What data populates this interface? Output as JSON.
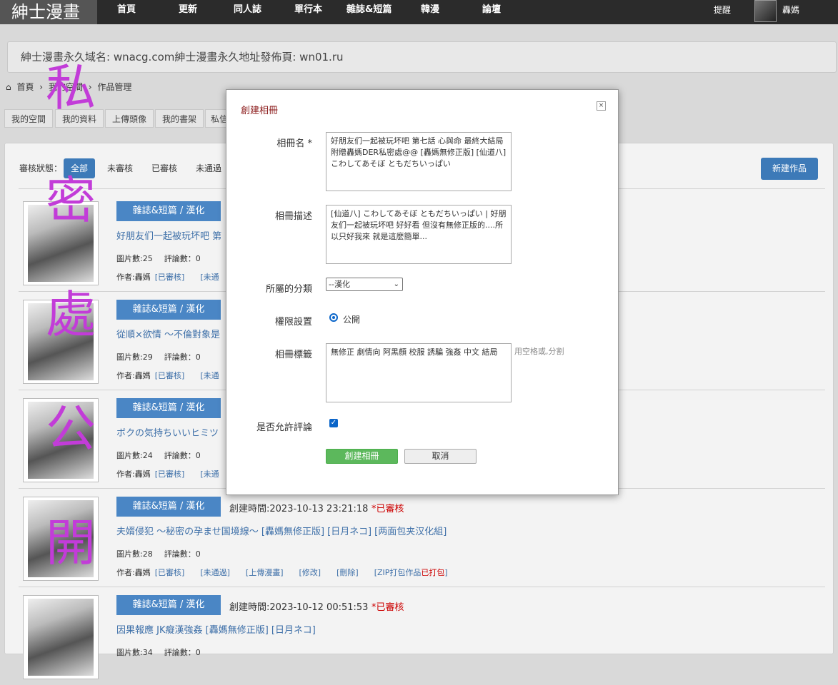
{
  "nav": {
    "logo": "紳士漫畫",
    "items": [
      "首頁",
      "更新",
      "同人誌",
      "單行本",
      "雜誌&短篇",
      "韓漫",
      "論壇"
    ],
    "remind": "提醒",
    "username": "轟媽"
  },
  "notice": "紳士漫畫永久域名: wnacg.com紳士漫畫永久地址發佈頁: wn01.ru",
  "breadcrumb": [
    "首頁",
    "我的空間",
    "作品管理"
  ],
  "subtabs": [
    "我的空間",
    "我的資料",
    "上傳頭像",
    "我的書架",
    "私信"
  ],
  "filter": {
    "label": "審核狀態：",
    "options": [
      "全部",
      "未審核",
      "已審核",
      "未通過"
    ]
  },
  "new_button": "新建作品",
  "watermark": [
    "私",
    "密",
    "處",
    "公",
    "開"
  ],
  "items": [
    {
      "category": "雜誌&短篇 / 漢化",
      "title": "好朋友们一起被玩坏吧 第",
      "meta": [
        "圖片數:25",
        "評論數：0"
      ],
      "author": "作者:轟媽",
      "links": [
        "[已審核]",
        "[未通"
      ]
    },
    {
      "category": "雜誌&短篇 / 漢化",
      "title": "從順×欲情 ～不倫對象是",
      "meta": [
        "圖片數:29",
        "評論數：0"
      ],
      "author": "作者:轟媽",
      "links": [
        "[已審核]",
        "[未通"
      ]
    },
    {
      "category": "雜誌&短篇 / 漢化",
      "title": "ボクの気持ちいいヒミツ",
      "meta": [
        "圖片數:24",
        "評論數：0"
      ],
      "author": "作者:轟媽",
      "links": [
        "[已審核]",
        "[未通"
      ]
    },
    {
      "category": "雜誌&短篇 / 漢化",
      "title": "夫婿侵犯 ～秘密の孕ませ国境線～ [轟媽無修正版] [日月ネコ] [两面包夹汉化組]",
      "meta": [
        "圖片數:28",
        "評論數：0"
      ],
      "author": "作者:轟媽",
      "links": [
        "[已審核]",
        "[未通過]",
        "[上傳漫畫]",
        "[修改]",
        "[刪除]"
      ],
      "zip": "[ZIP打包作品",
      "zip_red": "已打包",
      "zip_end": "]",
      "time": "創建時間:2023-10-13 23:21:18",
      "status": "*已審核"
    },
    {
      "category": "雜誌&短篇 / 漢化",
      "title": "因果報應 JK癡漢強姦 [轟媽無修正版] [日月ネコ]",
      "meta": [
        "圖片數:34",
        "評論數：0"
      ],
      "author": "",
      "links": [],
      "time": "創建時間:2023-10-12 00:51:53",
      "status": "*已審核"
    }
  ],
  "modal": {
    "title": "創建相冊",
    "close": "×",
    "name_label": "相冊名 *",
    "name_value": "好朋友们一起被玩坏吧 第七話 心與命 最終大結局 附贈轟媽DER私密處@@ [轟媽無修正版] [仙道八] こわしてあそぼ ともだちいっぱい",
    "desc_label": "相冊描述",
    "desc_value": "[仙道八] こわしてあそぼ ともだちいっぱい | 好朋友们一起被玩坏吧 好好看 但沒有無修正版的....所以只好我來 就是這麼簡單...",
    "category_label": "所屬的分類",
    "category_value": "--漢化",
    "perm_label": "權限設置",
    "perm_value": "公開",
    "tags_label": "相冊標籤",
    "tags_value": "無修正 劇情向 阿黑顏 校服 誘騙 強姦 中文 結局",
    "tags_hint": "用空格或,分割",
    "comment_label": "是否允許評論",
    "submit": "創建相冊",
    "cancel": "取消"
  }
}
